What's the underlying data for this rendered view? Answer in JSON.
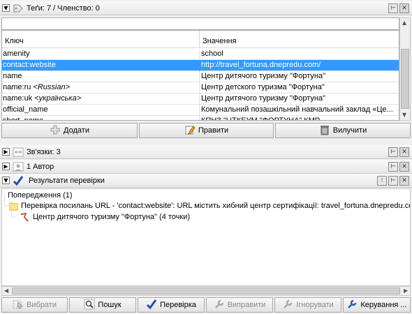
{
  "tags_panel": {
    "title": "Теґи: 7 / Членство: 0",
    "toggle": "▼",
    "table": {
      "headers": [
        "Ключ",
        "Значення"
      ],
      "rows": [
        {
          "key": "amenity",
          "lang": "",
          "value": "school"
        },
        {
          "key": "contact:website",
          "lang": "",
          "value": "http://travel_fortuna.dnepredu.com/"
        },
        {
          "key": "name",
          "lang": "",
          "value": "Центр дитячого туризму \"Фортуна\""
        },
        {
          "key": "name:ru ",
          "lang": "<Russian>",
          "value": "Центр детского туризма \"Фортуна\""
        },
        {
          "key": "name:uk ",
          "lang": "<українська>",
          "value": "Центр дитячого туризму \"Фортуна\""
        },
        {
          "key": "official_name",
          "lang": "",
          "value": "Комунальний позашкільний навчальний заклад «Це..."
        },
        {
          "key": "short_name",
          "lang": "",
          "value": "КПНЗ \"ЦТКЕУМ \"ФОРТУНА\" КМР"
        }
      ],
      "selected_row": 1
    },
    "buttons": {
      "add": "Додати",
      "edit": "Правити",
      "delete": "Вилучити"
    }
  },
  "relations_panel": {
    "title": "Зв'язки: 3",
    "toggle": "▶"
  },
  "authors_panel": {
    "title": "1 Автор",
    "toggle": "▶"
  },
  "validation_panel": {
    "title": "Результати перевірки",
    "toggle": "▼",
    "tree": {
      "group": "Попередження (1)",
      "warning": "Перевірка посилань URL - 'contact:website': URL містить хибний центр сертифікації: travel_fortuna.dnepredu.com",
      "primitive": "Центр дитячого туризму \"Фортуна\" (4 точки)"
    }
  },
  "bottom_toolbar": {
    "select": "Вибрати",
    "zoom": "Пошук",
    "validate": "Перевірка",
    "fix": "Виправити",
    "ignore": "Ігнорувати",
    "manage": "Керування ..."
  },
  "colors": {
    "selection": "#3399ff",
    "check": "#1f4fa8"
  }
}
